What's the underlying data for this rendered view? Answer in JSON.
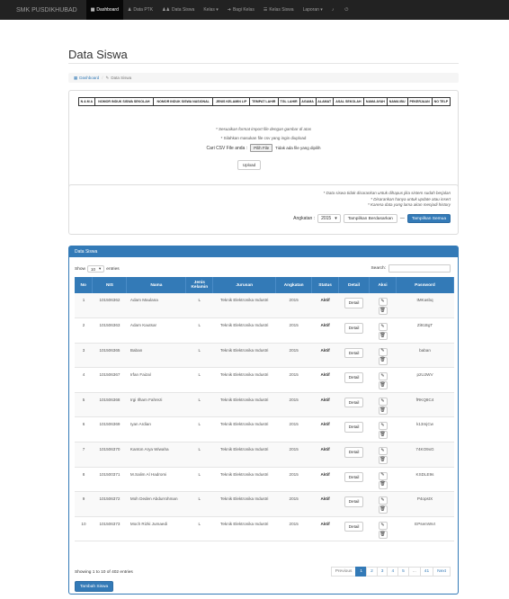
{
  "navbar": {
    "brand": "SMK PUSDIKHUBAD",
    "items": [
      {
        "label": "Dashboard",
        "icon": "calendar-icon",
        "active": true
      },
      {
        "label": "Data PTK",
        "icon": "user-icon",
        "active": false
      },
      {
        "label": "Data Siswa",
        "icon": "users-icon",
        "active": false
      },
      {
        "label": "Kelas ▾",
        "icon": "",
        "active": false
      },
      {
        "label": "Bagi Kelas",
        "icon": "sign-in-icon",
        "active": false
      },
      {
        "label": "Kelas Siswa",
        "icon": "list-icon",
        "active": false
      },
      {
        "label": "Laporan ▾",
        "icon": "",
        "active": false
      },
      {
        "label": "",
        "icon": "bell-icon",
        "active": false
      },
      {
        "label": "",
        "icon": "power-icon",
        "active": false
      }
    ]
  },
  "page": {
    "title": "Data Siswa",
    "breadcrumb": {
      "home": "Dashboard",
      "separator": "/",
      "current": "Data Siswa"
    }
  },
  "import": {
    "columns": [
      "N A M A",
      "NOMOR INDUK SISWA SEKOLAH",
      "NOMOR INDUK SISWA NASIONAL",
      "JENIS KELAMIN L/P",
      "TEMPAT LAHIR",
      "TGL LAHIR",
      "AGAMA",
      "ALAMAT",
      "ASAL SEKOLAH",
      "NAMA AYAH",
      "NAMA IBU",
      "PEKERJAAN",
      "NO TELP"
    ],
    "note1": "* Sesuaikan format import file dengan gambar di atas",
    "note2": "* Silahkan masukan file csv yang ingin diupload",
    "file_label": "Cari CSV File anda :",
    "choose_button": "Pilih File",
    "no_file": "Tidak ada file yang dipilih",
    "upload_button": "Upload"
  },
  "filter": {
    "note1": "* Data siswa tidak disarankan untuk dihapus jika sistem sudah berjalan",
    "note2": "* Disarankan hanya untuk update atau insert",
    "note3": "* Karena data yang lama akan menjadi history",
    "angkatan_label": "Angkatan :",
    "angkatan_value": "2015",
    "btn_filter": "Tampilkan Berdasarkan",
    "dash": "—",
    "btn_all": "Tampilkan Semua"
  },
  "data_panel": {
    "heading": "Data Siswa",
    "show_label": "Show",
    "show_value": "10",
    "entries_label": "entries",
    "search_label": "Search:",
    "headers": [
      "No",
      "NIS",
      "Nama",
      "Jenis Kelamin",
      "Jurusan",
      "Angkatan",
      "Status",
      "Detail",
      "Aksi",
      "Password"
    ],
    "rows": [
      {
        "no": "1",
        "nis": "101506362",
        "nama": "Adam Maulana",
        "jk": "L",
        "jurusan": "Teknik Elektronika Industri",
        "angkatan": "2015",
        "status": "Aktif",
        "detail": "Detail",
        "password": "tMKasbq"
      },
      {
        "no": "2",
        "nis": "101506363",
        "nama": "Adam Kautsar",
        "jk": "L",
        "jurusan": "Teknik Elektronika Industri",
        "angkatan": "2015",
        "status": "Aktif",
        "detail": "Detail",
        "password": "Zi91BgT"
      },
      {
        "no": "3",
        "nis": "101506365",
        "nama": "Baban",
        "jk": "L",
        "jurusan": "Teknik Elektronika Industri",
        "angkatan": "2015",
        "status": "Aktif",
        "detail": "Detail",
        "password": "baban"
      },
      {
        "no": "4",
        "nis": "101506367",
        "nama": "Irfan Faizal",
        "jk": "L",
        "jurusan": "Teknik Elektronika Industri",
        "angkatan": "2015",
        "status": "Aktif",
        "detail": "Detail",
        "password": "p2UJWV"
      },
      {
        "no": "5",
        "nis": "101506368",
        "nama": "Irgi Ilham Fahrezi",
        "jk": "L",
        "jurusan": "Teknik Elektronika Industri",
        "angkatan": "2015",
        "status": "Aktif",
        "detail": "Detail",
        "password": "fRKQ8C4"
      },
      {
        "no": "6",
        "nis": "101506369",
        "nama": "Iyan Ardian",
        "jk": "L",
        "jurusan": "Teknik Elektronika Industri",
        "angkatan": "2015",
        "status": "Aktif",
        "detail": "Detail",
        "password": "k13mjCw"
      },
      {
        "no": "7",
        "nis": "101506370",
        "nama": "Kanton Arya Wiwaha",
        "jk": "L",
        "jurusan": "Teknik Elektronika Industri",
        "angkatan": "2015",
        "status": "Aktif",
        "detail": "Detail",
        "password": "74KO9xG"
      },
      {
        "no": "8",
        "nis": "101500371",
        "nama": "M.Salim Al Hadromi",
        "jk": "L",
        "jurusan": "Teknik Elektronika Industri",
        "angkatan": "2015",
        "status": "Aktif",
        "detail": "Detail",
        "password": "KSDLE9s"
      },
      {
        "no": "9",
        "nis": "101506372",
        "nama": "Moh Deden Abdurrohman",
        "jk": "L",
        "jurusan": "Teknik Elektronika Industri",
        "angkatan": "2015",
        "status": "Aktif",
        "detail": "Detail",
        "password": "P4opstX"
      },
      {
        "no": "10",
        "nis": "101506373",
        "nama": "Moch Rizki Jumaedi",
        "jk": "L",
        "jurusan": "Teknik Elektronika Industri",
        "angkatan": "2015",
        "status": "Aktif",
        "detail": "Detail",
        "password": "EPsemWvt"
      }
    ],
    "showing": "Showing 1 to 10 of 402 entries",
    "pages": [
      "Previous",
      "1",
      "2",
      "3",
      "4",
      "5",
      "...",
      "41",
      "Next"
    ],
    "active_page": "1",
    "add_button": "Tambah Siswa"
  },
  "colors": {
    "navbar": "#222222",
    "primary": "#337ab7",
    "link": "#337ab7"
  }
}
